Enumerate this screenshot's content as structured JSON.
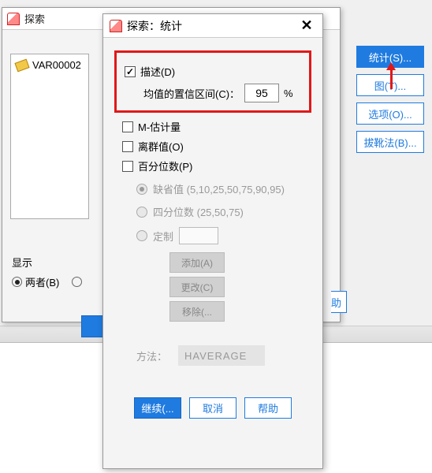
{
  "explore": {
    "title": "探索",
    "var_name": "VAR00002",
    "display_label": "显示",
    "both_label": "两者(B)"
  },
  "side": {
    "stats": "统计(S)...",
    "plots": "图(T)...",
    "options": "选项(O)...",
    "bootstrap": "拔靴法(B)...",
    "partial": "助"
  },
  "stats": {
    "title": "探索：统计",
    "describe": "描述(D)",
    "ci_label": "均值的置信区间(C)：",
    "ci_value": "95",
    "ci_unit": "%",
    "m_est": "M-估计量",
    "outliers": "离群值(O)",
    "percentiles": "百分位数(P)",
    "miss_label": "缺省值 (5,10,25,50,75,90,95)",
    "quart_label": "四分位数 (25,50,75)",
    "custom_label": "定制",
    "add": "添加(A)",
    "change": "更改(C)",
    "remove": "移除(...",
    "method_label": "方法：",
    "method_value": "HAVERAGE",
    "continue": "继续(...",
    "cancel": "取消",
    "help": "帮助"
  }
}
